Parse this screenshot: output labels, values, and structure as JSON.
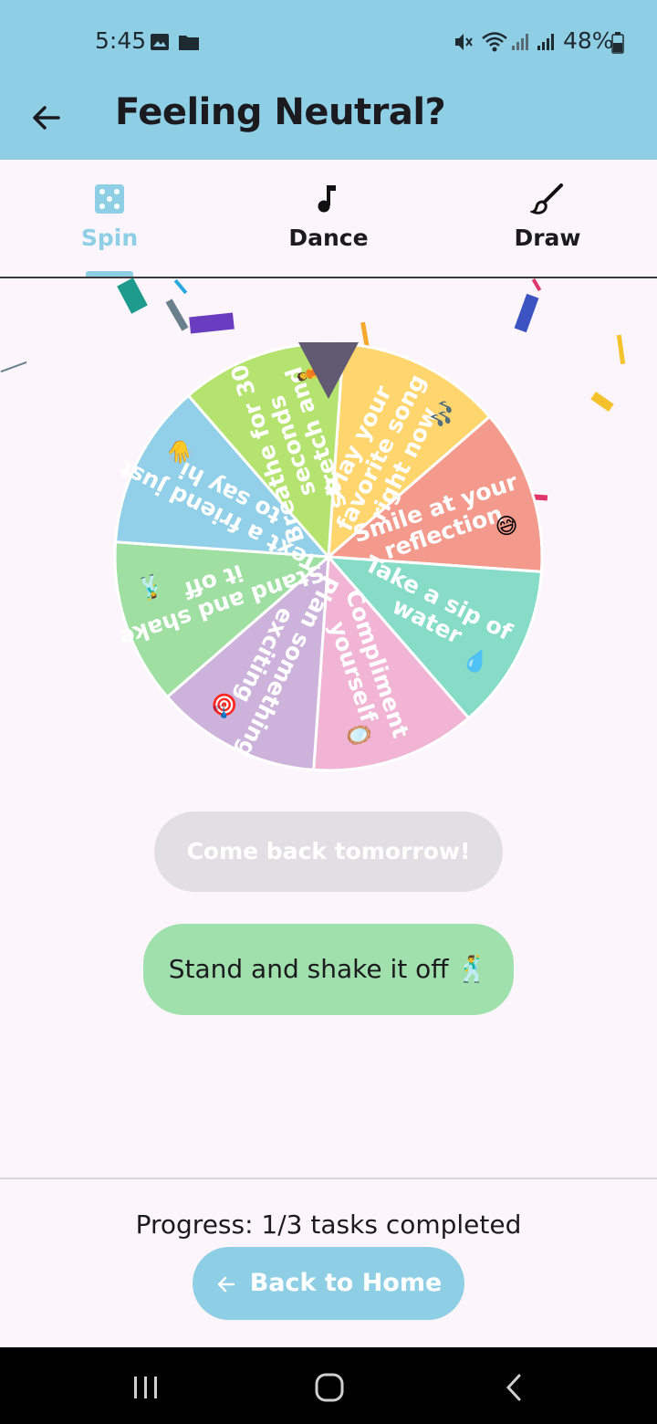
{
  "status_bar": {
    "time": "5:45",
    "battery": "48%",
    "icons": [
      "image-icon",
      "folder-icon",
      "mute-icon",
      "wifi-icon",
      "signal-icon",
      "signal-icon",
      "battery-icon"
    ]
  },
  "app_bar": {
    "title": "Feeling Neutral?",
    "back_icon": "arrow-left-icon"
  },
  "tabs": [
    {
      "label": "Spin",
      "icon": "dice-icon",
      "selected": true
    },
    {
      "label": "Dance",
      "icon": "music-note-icon",
      "selected": false
    },
    {
      "label": "Draw",
      "icon": "brush-icon",
      "selected": false
    }
  ],
  "wheel": {
    "segments": [
      {
        "line1": "Play your",
        "line2": "favorite song",
        "line3": "right now",
        "emoji": "🎶",
        "color": "#ffd66e"
      },
      {
        "line1": "Smile at your",
        "line2": "reflection",
        "line3": "",
        "emoji": "😅",
        "color": "#f49a8c"
      },
      {
        "line1": "Take a sip of",
        "line2": "water",
        "line3": "",
        "emoji": "💧",
        "color": "#86dcc7"
      },
      {
        "line1": "Compliment",
        "line2": "yourself",
        "line3": "",
        "emoji": "🪞",
        "color": "#f1b4d4"
      },
      {
        "line1": "Plan something",
        "line2": "exciting",
        "line3": "",
        "emoji": "🎯",
        "color": "#cdb3dc"
      },
      {
        "line1": "Stand and shake",
        "line2": "it off",
        "line3": "",
        "emoji": "🕺",
        "color": "#9fe0a2"
      },
      {
        "line1": "Text a friend just",
        "line2": "to say hi",
        "line3": "",
        "emoji": "👋",
        "color": "#92cfe8"
      },
      {
        "line1": "Breathe for 30",
        "line2": "seconds",
        "line3": "stretch and",
        "emoji": "🧘",
        "color": "#b4e36f"
      }
    ],
    "pointer_color": "#625a72"
  },
  "spin_button": {
    "label": "Come back tomorrow!",
    "enabled": false
  },
  "result": {
    "text": "Stand and shake it off 🕺"
  },
  "progress": {
    "text": "Progress: 1/3 tasks completed",
    "done": 1,
    "total": 3
  },
  "home_button": {
    "label": "Back to Home",
    "icon": "arrow-left-icon"
  },
  "nav_bar": {
    "icons": [
      "recents-icon",
      "home-icon",
      "back-icon"
    ]
  }
}
